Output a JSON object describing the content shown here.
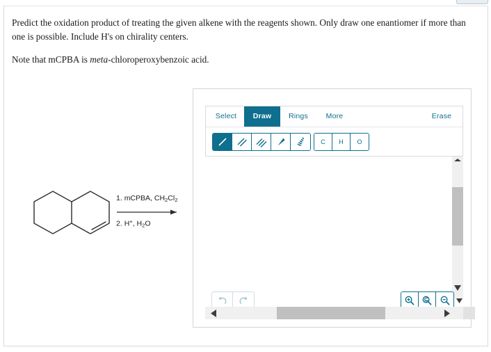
{
  "prompt": {
    "line1_a": "Predict the oxidation product of treating the given alkene with the reagents shown. Only draw one enantiomer if more than one is possible. Include H's on chirality centers.",
    "line2_a": "Note that mCPBA is ",
    "line2_italic": "meta",
    "line2_b": "-chloroperoxybenzoic acid."
  },
  "scheme": {
    "reagent_top_num": "1.",
    "reagent_top_name": "mCPBA, CH",
    "reagent_top_sub1": "2",
    "reagent_top_mid": "Cl",
    "reagent_top_sub2": "2",
    "reagent_bottom_num": "2.",
    "reagent_bottom_a": "H",
    "reagent_bottom_sup": "+",
    "reagent_bottom_b": ", H",
    "reagent_bottom_sub": "2",
    "reagent_bottom_c": "O",
    "molecule_name": "octahydronaphthalene-alkene"
  },
  "editor": {
    "tabs": [
      {
        "label": "Select",
        "active": false
      },
      {
        "label": "Draw",
        "active": true
      },
      {
        "label": "Rings",
        "active": false
      },
      {
        "label": "More",
        "active": false
      }
    ],
    "erase_label": "Erase",
    "bond_tools": [
      {
        "name": "single-bond",
        "selected": true
      },
      {
        "name": "double-bond",
        "selected": false
      },
      {
        "name": "triple-bond",
        "selected": false
      },
      {
        "name": "wedge-bond",
        "selected": false
      },
      {
        "name": "hash-bond",
        "selected": false
      }
    ],
    "atom_tools": [
      {
        "label": "C"
      },
      {
        "label": "H"
      },
      {
        "label": "O"
      }
    ],
    "history": [
      {
        "name": "undo"
      },
      {
        "name": "redo"
      }
    ],
    "zoom_controls": [
      {
        "name": "zoom-in"
      },
      {
        "name": "zoom-reset"
      },
      {
        "name": "zoom-out"
      }
    ],
    "accent_color": "#0e6f8e",
    "canvas_content": ""
  }
}
